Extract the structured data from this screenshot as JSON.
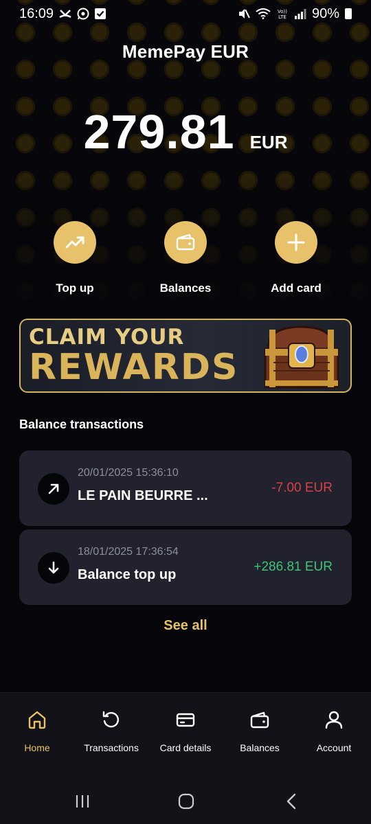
{
  "status_bar": {
    "time": "16:09",
    "battery": "90%",
    "left_icons": [
      "missed-call-icon",
      "whatsapp-icon",
      "checklist-icon"
    ],
    "right_icons": [
      "mute-icon",
      "wifi-icon",
      "volte-icon",
      "signal-icon",
      "battery-icon"
    ],
    "volte_label": "Vo))\nLTE"
  },
  "header": {
    "title": "MemePay EUR"
  },
  "balance": {
    "amount": "279.81",
    "currency": "EUR"
  },
  "actions": [
    {
      "label": "Top up",
      "icon": "trending-up-icon"
    },
    {
      "label": "Balances",
      "icon": "wallet-icon"
    },
    {
      "label": "Add card",
      "icon": "plus-icon"
    }
  ],
  "banner": {
    "line1": "CLAIM YOUR",
    "line2": "REWARDS"
  },
  "transactions_section": {
    "title": "Balance transactions",
    "items": [
      {
        "date": "20/01/2025 15:36:10",
        "title": "LE PAIN BEURRE ...",
        "amount": "-7.00 EUR",
        "direction": "out",
        "icon": "arrow-up-right-icon"
      },
      {
        "date": "18/01/2025 17:36:54",
        "title": "Balance top up",
        "amount": "+286.81 EUR",
        "direction": "in",
        "icon": "arrow-down-icon"
      }
    ],
    "see_all": "See all"
  },
  "bottom_nav": {
    "items": [
      {
        "label": "Home",
        "icon": "home-icon",
        "active": true
      },
      {
        "label": "Transactions",
        "icon": "history-icon",
        "active": false
      },
      {
        "label": "Card details",
        "icon": "credit-card-icon",
        "active": false
      },
      {
        "label": "Balances",
        "icon": "wallet-icon",
        "active": false
      },
      {
        "label": "Account",
        "icon": "user-icon",
        "active": false
      }
    ]
  },
  "system_nav": [
    "recents-icon",
    "home-button-icon",
    "back-icon"
  ],
  "colors": {
    "accent": "#e7c26a",
    "background": "#05050a",
    "card": "#21222d",
    "negative": "#d6404a",
    "positive": "#3ec475",
    "muted": "#8b8e9c"
  }
}
